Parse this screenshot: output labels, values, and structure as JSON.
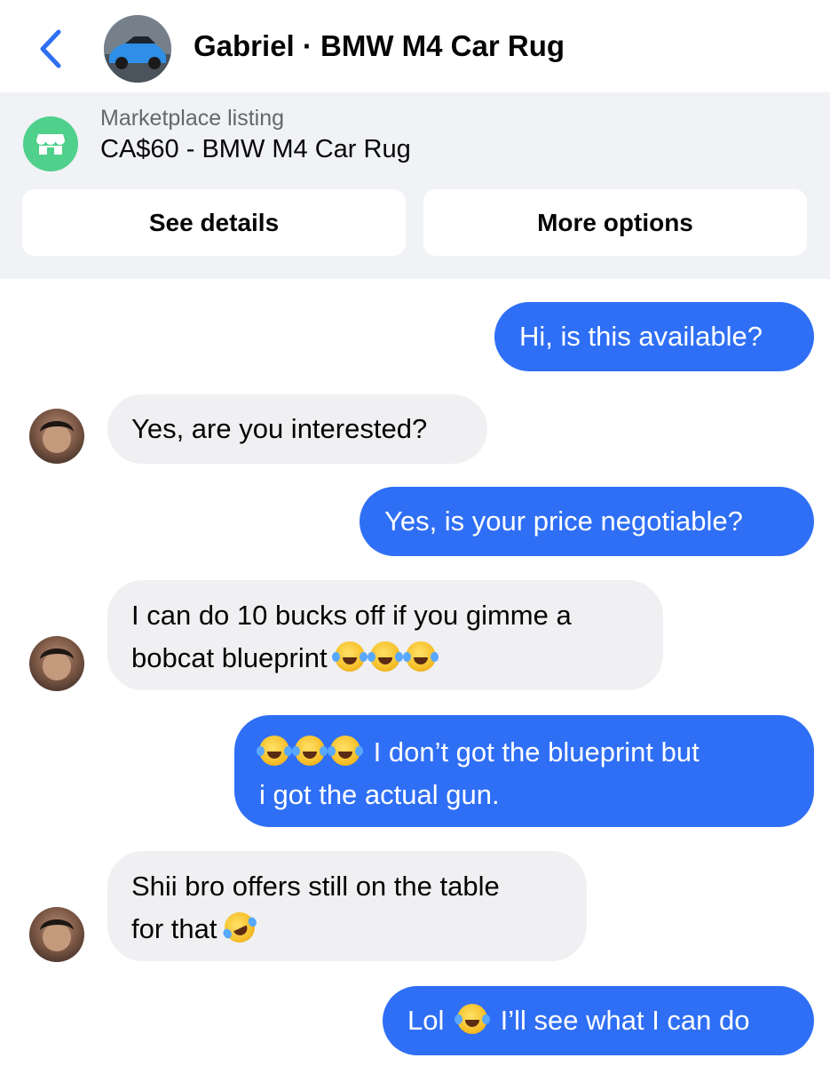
{
  "header": {
    "title": "Gabriel · BMW M4 Car Rug",
    "accent_color": "#2f6ff5"
  },
  "listing": {
    "subtitle": "Marketplace listing",
    "title": "CA$60 - BMW M4 Car Rug",
    "icon_color": "#4fd08b",
    "see_details_label": "See details",
    "more_options_label": "More options"
  },
  "messages": [
    {
      "sender": "me",
      "text": "Hi, is this available?"
    },
    {
      "sender": "them",
      "text": "Yes, are you interested?"
    },
    {
      "sender": "me",
      "text": "Yes, is your price negotiable?"
    },
    {
      "sender": "them",
      "line1": "I can do 10 bucks off if you gimme a",
      "line2": "bobcat blueprint"
    },
    {
      "sender": "me",
      "line1": "I don’t got the blueprint but",
      "line2": "i got the actual gun."
    },
    {
      "sender": "them",
      "line1": "Shii bro offers still on the table",
      "line2": "for that"
    },
    {
      "sender": "me",
      "before": "Lol",
      "after": "I’ll see what I can do"
    }
  ],
  "colors": {
    "outgoing_bubble": "#2f6ff5",
    "incoming_bubble": "#f0f0f2",
    "listing_bg": "#f0f2f5"
  }
}
